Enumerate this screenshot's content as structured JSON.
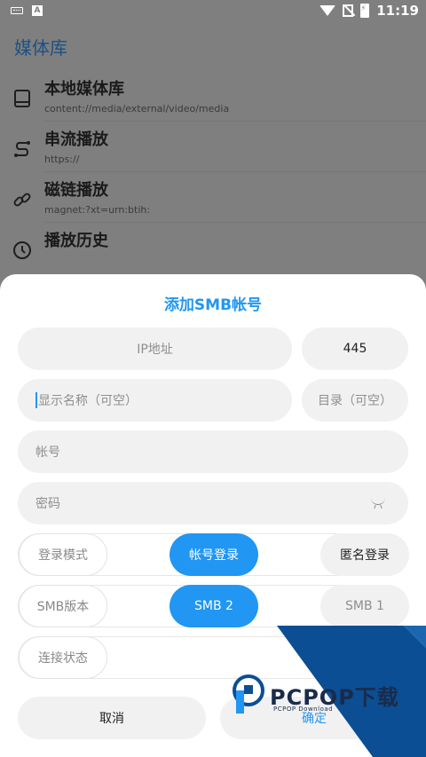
{
  "status_bar": {
    "time": "11:19",
    "left_icons": [
      "keyboard-icon",
      "a-icon"
    ],
    "right_icons": [
      "wifi-icon",
      "no-sim-icon",
      "battery-charging-icon"
    ]
  },
  "library": {
    "title": "媒体库",
    "items": [
      {
        "icon": "tablet-icon",
        "title": "本地媒体库",
        "subtitle": "content://media/external/video/media"
      },
      {
        "icon": "stream-icon",
        "title": "串流播放",
        "subtitle": "https://"
      },
      {
        "icon": "link-icon",
        "title": "磁链播放",
        "subtitle": "magnet:?xt=urn:btih:"
      },
      {
        "icon": "clock-icon",
        "title": "播放历史",
        "subtitle": ""
      }
    ]
  },
  "dialog": {
    "title": "添加SMB帐号",
    "ip_placeholder": "IP地址",
    "port_value": "445",
    "name_placeholder": "显示名称（可空）",
    "dir_placeholder": "目录（可空）",
    "account_placeholder": "帐号",
    "password_placeholder": "密码",
    "login_mode": {
      "label": "登录模式",
      "options": [
        "帐号登录",
        "匿名登录"
      ],
      "selected": "帐号登录"
    },
    "smb_version": {
      "label": "SMB版本",
      "options": [
        "SMB 2",
        "SMB 1"
      ],
      "selected": "SMB 2"
    },
    "connection_status_label": "连接状态",
    "cancel_label": "取消",
    "confirm_label": "确定",
    "accent_color": "#2196f3"
  },
  "watermark": {
    "brand": "PCPOP下载",
    "sub": "PCPOP Download"
  }
}
